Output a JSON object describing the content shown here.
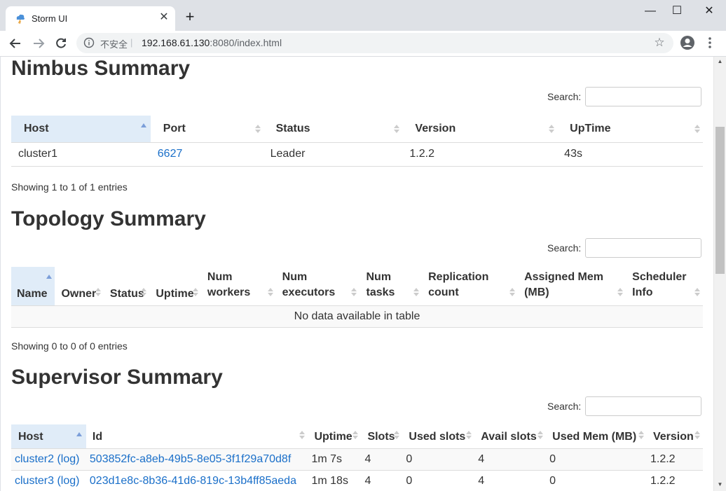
{
  "browser": {
    "tab_title": "Storm UI",
    "insecure_label": "不安全",
    "url_host": "192.168.61.130",
    "url_rest": ":8080/index.html"
  },
  "nimbus": {
    "heading": "Nimbus Summary",
    "search_label": "Search:",
    "columns": [
      "Host",
      "Port",
      "Status",
      "Version",
      "UpTime"
    ],
    "rows": [
      {
        "host": "cluster1",
        "port": "6627",
        "status": "Leader",
        "version": "1.2.2",
        "uptime": "43s"
      }
    ],
    "info": "Showing 1 to 1 of 1 entries"
  },
  "topology": {
    "heading": "Topology Summary",
    "search_label": "Search:",
    "columns": [
      "Name",
      "Owner",
      "Status",
      "Uptime",
      "Num workers",
      "Num executors",
      "Num tasks",
      "Replication count",
      "Assigned Mem (MB)",
      "Scheduler Info"
    ],
    "empty": "No data available in table",
    "info": "Showing 0 to 0 of 0 entries"
  },
  "supervisor": {
    "heading": "Supervisor Summary",
    "search_label": "Search:",
    "columns": [
      "Host",
      "Id",
      "Uptime",
      "Slots",
      "Used slots",
      "Avail slots",
      "Used Mem (MB)",
      "Version"
    ],
    "rows": [
      {
        "host": "cluster2 (log)",
        "id": "503852fc-a8eb-49b5-8e05-3f1f29a70d8f",
        "uptime": "1m 7s",
        "slots": "4",
        "used": "0",
        "avail": "4",
        "mem": "0",
        "version": "1.2.2"
      },
      {
        "host": "cluster3 (log)",
        "id": "023d1e8c-8b36-41d6-819c-13b4ff85aeda",
        "uptime": "1m 18s",
        "slots": "4",
        "used": "0",
        "avail": "4",
        "mem": "0",
        "version": "1.2.2"
      }
    ]
  },
  "colors": {
    "link": "#1a6fc9",
    "sorted_header": "#e0ecf8",
    "sort_arrow": "#7b9ed9"
  }
}
